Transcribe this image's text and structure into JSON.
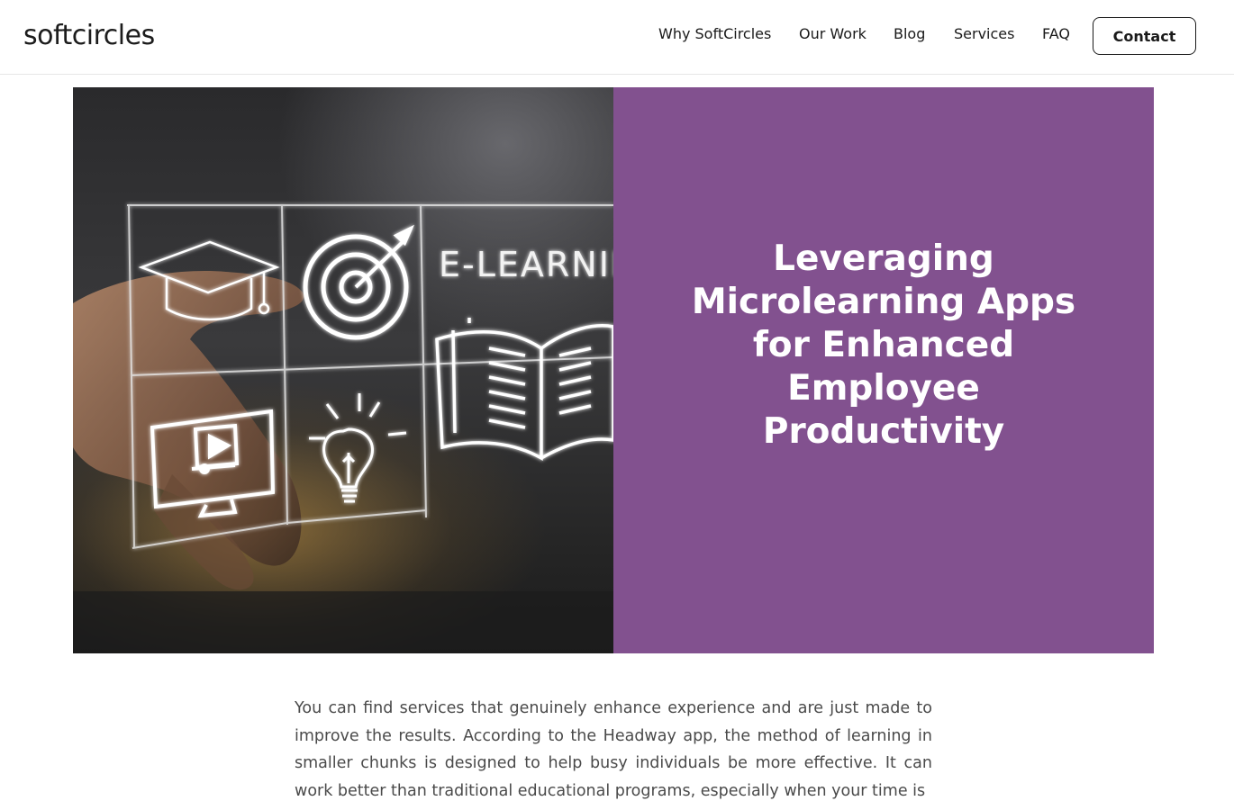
{
  "header": {
    "logo": "softcircles",
    "nav": [
      {
        "label": "Why SoftCircles"
      },
      {
        "label": "Our Work"
      },
      {
        "label": "Blog"
      },
      {
        "label": "Services"
      },
      {
        "label": "FAQ"
      }
    ],
    "contact_label": "Contact"
  },
  "hero": {
    "image_text": "E-LEARNIN",
    "title": "Leveraging Microlearning Apps for Enhanced Employee Productivity",
    "panel_color": "#82518f"
  },
  "article": {
    "paragraph": "You can find services that genuinely enhance experience and are just made to improve the results. According to the Headway app, the method of learning in smaller chunks is designed to help busy individuals be more effective. It can work better than traditional educational programs, especially when your time is"
  }
}
